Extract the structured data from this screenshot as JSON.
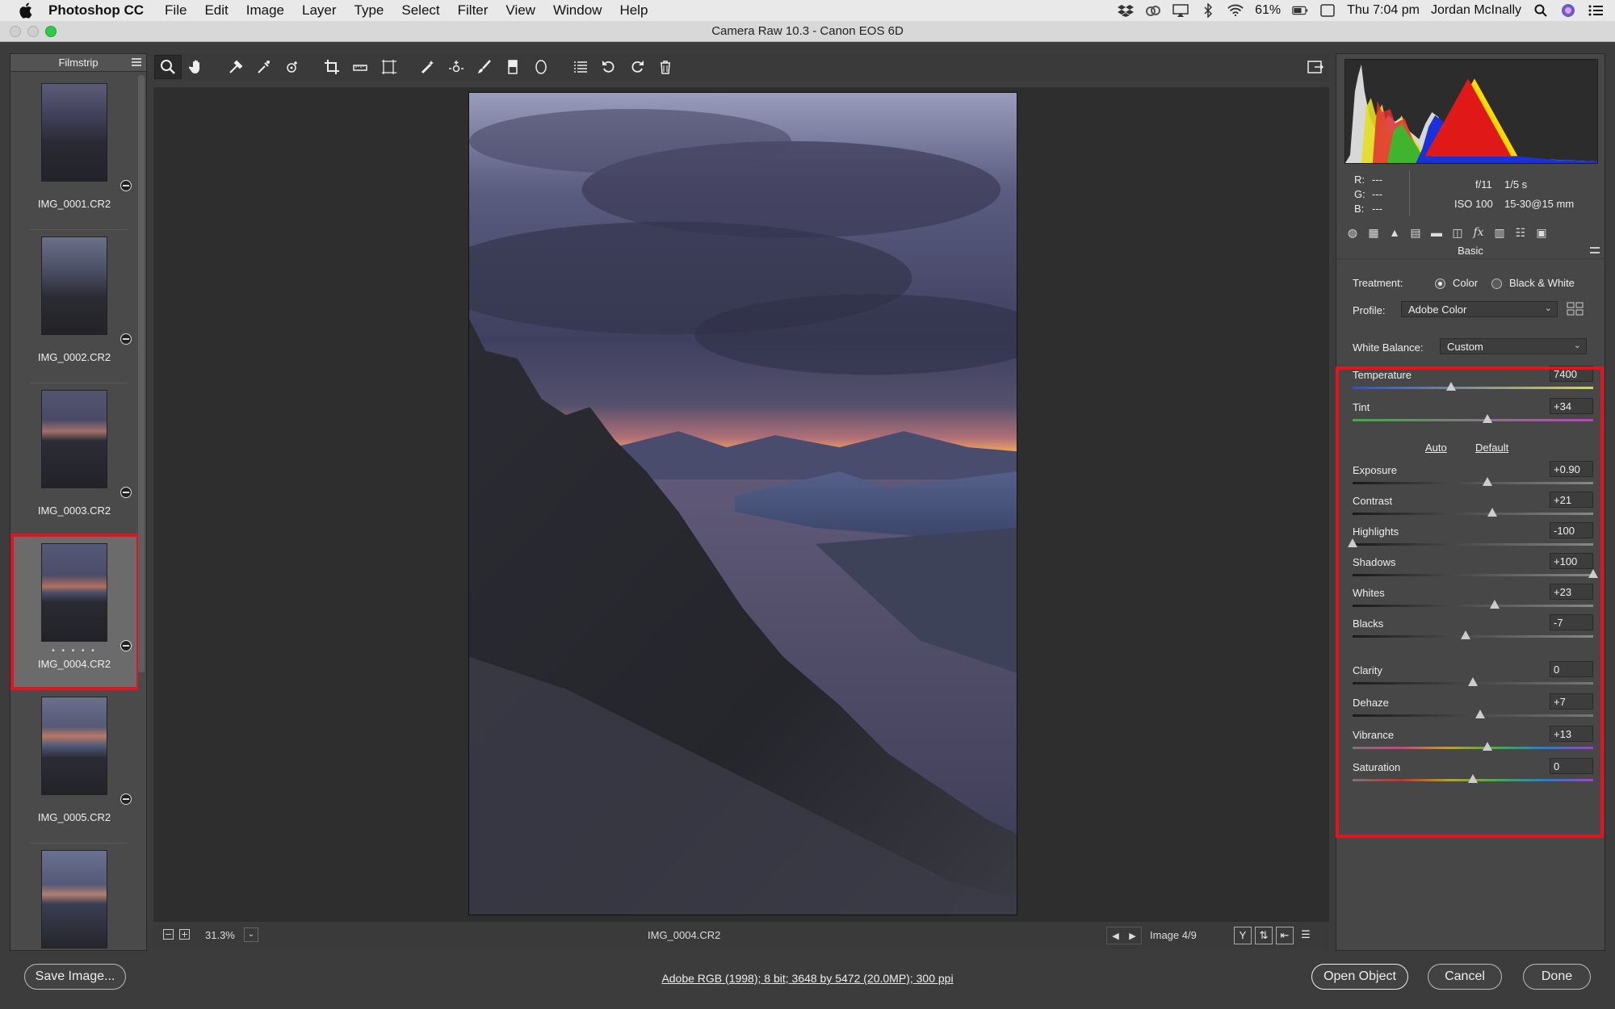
{
  "menubar": {
    "app": "Photoshop CC",
    "items": [
      "File",
      "Edit",
      "Image",
      "Layer",
      "Type",
      "Select",
      "Filter",
      "View",
      "Window",
      "Help"
    ],
    "battery": "61%",
    "clock": "Thu 7:04 pm",
    "user": "Jordan McInally"
  },
  "window": {
    "title": "Camera Raw 10.3  -  Canon EOS 6D"
  },
  "filmstrip": {
    "title": "Filmstrip",
    "items": [
      {
        "name": "IMG_0001.CR2"
      },
      {
        "name": "IMG_0002.CR2"
      },
      {
        "name": "IMG_0003.CR2"
      },
      {
        "name": "IMG_0004.CR2",
        "selected": true,
        "stars": "• • • • •"
      },
      {
        "name": "IMG_0005.CR2"
      },
      {
        "name": ""
      }
    ]
  },
  "canvas_bar": {
    "zoom": "31.3%",
    "filename": "IMG_0004.CR2",
    "image_count": "Image 4/9",
    "view_y": "Y"
  },
  "readout": {
    "r": "R:",
    "g": "G:",
    "b": "B:",
    "r_val": "---",
    "g_val": "---",
    "b_val": "---",
    "aperture": "f/11",
    "shutter": "1/5 s",
    "iso": "ISO 100",
    "lens": "15-30@15 mm"
  },
  "panel": {
    "title": "Basic",
    "treatment_label": "Treatment:",
    "treatment_color": "Color",
    "treatment_bw": "Black & White",
    "profile_label": "Profile:",
    "profile_value": "Adobe Color",
    "wb_label": "White Balance:",
    "wb_value": "Custom",
    "auto": "Auto",
    "default": "Default",
    "sliders": [
      {
        "label": "Temperature",
        "value": "7400",
        "pos": 0.41
      },
      {
        "label": "Tint",
        "value": "+34",
        "pos": 0.56
      },
      {
        "label": "Exposure",
        "value": "+0.90",
        "pos": 0.56
      },
      {
        "label": "Contrast",
        "value": "+21",
        "pos": 0.58
      },
      {
        "label": "Highlights",
        "value": "-100",
        "pos": 0.0
      },
      {
        "label": "Shadows",
        "value": "+100",
        "pos": 1.0
      },
      {
        "label": "Whites",
        "value": "+23",
        "pos": 0.59
      },
      {
        "label": "Blacks",
        "value": "-7",
        "pos": 0.47
      },
      {
        "label": "Clarity",
        "value": "0",
        "pos": 0.5
      },
      {
        "label": "Dehaze",
        "value": "+7",
        "pos": 0.53
      },
      {
        "label": "Vibrance",
        "value": "+13",
        "pos": 0.56
      },
      {
        "label": "Saturation",
        "value": "0",
        "pos": 0.5
      }
    ]
  },
  "bottom": {
    "save": "Save Image...",
    "info": "Adobe RGB (1998); 8 bit; 3648 by 5472 (20.0MP); 300 ppi",
    "open": "Open Object",
    "cancel": "Cancel",
    "done": "Done"
  }
}
